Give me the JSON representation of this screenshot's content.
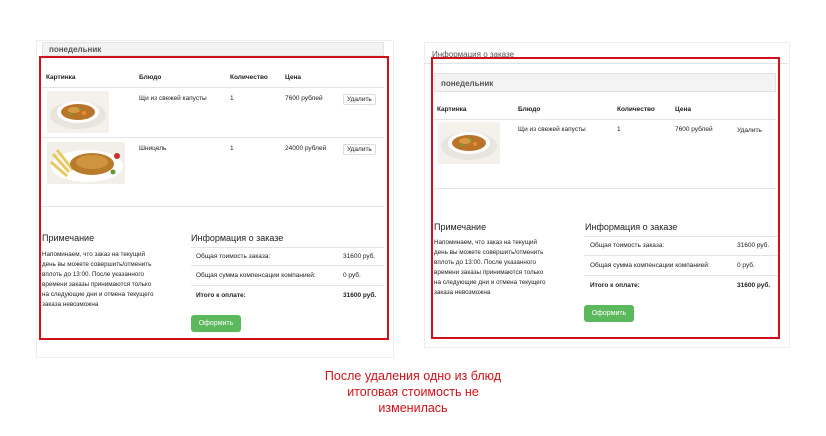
{
  "left": {
    "day": "понедельник",
    "columns": [
      "Картинка",
      "Блюдо",
      "Количество",
      "Цена"
    ],
    "rows": [
      {
        "dish": "Щи из свежей капусты",
        "qty": "1",
        "price": "7600 рублей",
        "action": "Удалить"
      },
      {
        "dish": "Шницель",
        "qty": "1",
        "price": "24000 рублей",
        "action": "Удалить"
      }
    ],
    "note_title": "Примечание",
    "note_lines": [
      "Напоминаем, что заказ на текущий",
      "день вы можете совершить/отменить",
      "вплоть до 13:00. После указанного",
      "времени заказы принимаются только",
      "на следующие дни и отмена текущего",
      "заказа невозможна"
    ],
    "order_title": "Информация о заказе",
    "summary": [
      {
        "label": "Общая тоимость заказа:",
        "value": "31600 руб.",
        "bold": false
      },
      {
        "label": "Общая сумма компенсации компанией:",
        "value": "0 руб.",
        "bold": false
      },
      {
        "label": "Итого к оплате:",
        "value": "31600 руб.",
        "bold": true
      }
    ],
    "order_button": "Оформить"
  },
  "right": {
    "top_title": "Информация о заказе",
    "day": "понедельник",
    "columns": [
      "Картинка",
      "Блюдо",
      "Количество",
      "Цена"
    ],
    "rows": [
      {
        "dish": "Щи из свежей капусты",
        "qty": "1",
        "price": "7600 рублей",
        "action": "Удалить"
      }
    ],
    "note_title": "Примечание",
    "note_lines": [
      "Напоминаем, что заказ на текущий",
      "день вы можете совершить/отменить",
      "вплоть до 13:00. После указанного",
      "времени заказы принимаются только",
      "на следующие дни и отмена текущего",
      "заказа невозможна"
    ],
    "order_title": "Информация о заказе",
    "summary": [
      {
        "label": "Общая тоимость заказа:",
        "value": "31600 руб.",
        "bold": false
      },
      {
        "label": "Общая сумма компенсации компанией:",
        "value": "0 руб.",
        "bold": false
      },
      {
        "label": "Итого к оплате:",
        "value": "31600 руб.",
        "bold": true
      }
    ],
    "order_button": "Оформить"
  },
  "caption_lines": [
    "После удаления одно из блюд",
    "итоговая стоимость не",
    "изменилась"
  ],
  "colors": {
    "highlight": "#d0111b",
    "button": "#5cb85c"
  }
}
